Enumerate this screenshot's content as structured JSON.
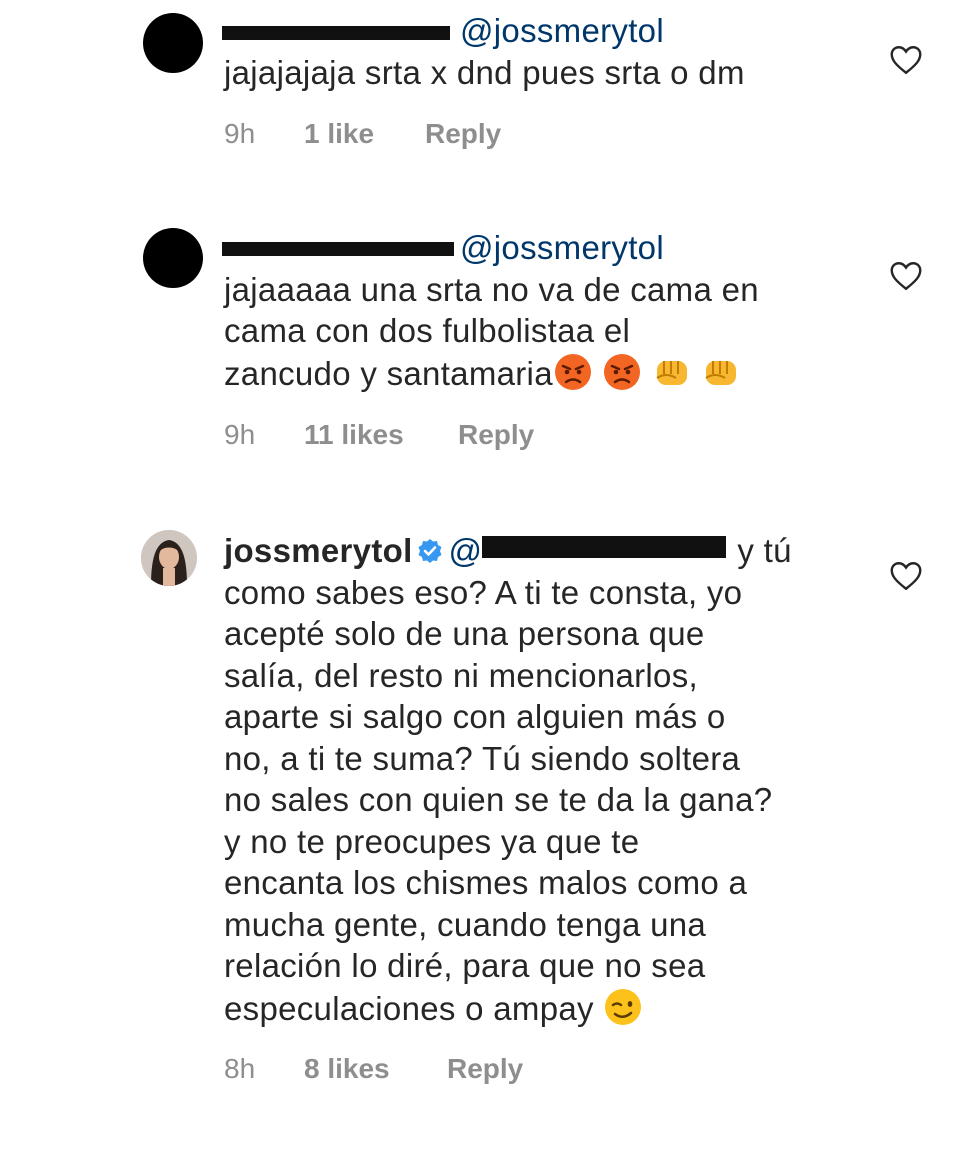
{
  "comments": [
    {
      "mention": "@jossmerytol",
      "text": "jajajajaja srta x dnd pues srta o dm",
      "time": "9h",
      "likes": "1 like",
      "reply": "Reply"
    },
    {
      "mention": "@jossmerytol",
      "line1": "jajaaaaa una srta no va  de cama en",
      "line2": "cama con dos fulbolistaa el",
      "line3": "zancudo y  santamaria",
      "time": "9h",
      "likes": "11 likes",
      "reply": "Reply"
    },
    {
      "username": "jossmerytol",
      "mention_prefix": "@",
      "after_mention": "y tú",
      "lines": [
        "como sabes eso? A ti te consta, yo",
        "acepté solo de una persona que",
        "salía, del resto ni mencionarlos,",
        "aparte si salgo con alguien más o",
        "no, a ti te suma? Tú siendo soltera",
        "no sales con quien se te da la gana?",
        "y no te preocupes ya que te",
        "encanta los chismes malos como a",
        "mucha gente, cuando tenga una",
        "relación lo diré, para que no sea",
        "especulaciones o ampay"
      ],
      "time": "8h",
      "likes": "8 likes",
      "reply": "Reply"
    }
  ],
  "icons": {
    "heart": "heart-outline-icon",
    "verified": "verified-badge-icon",
    "angry": "angry-face-emoji",
    "fist": "oncoming-fist-emoji",
    "wink": "winking-face-emoji"
  },
  "colors": {
    "mention": "#00376b",
    "meta": "#8e8e8e",
    "verified": "#3897f0"
  }
}
